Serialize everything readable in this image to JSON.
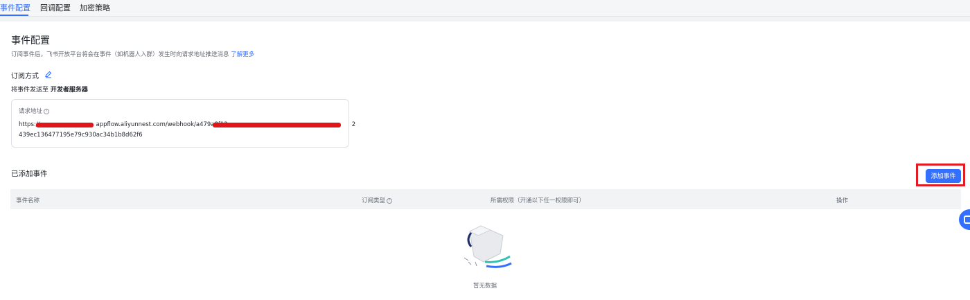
{
  "tabs": [
    "事件配置",
    "回调配置",
    "加密策略"
  ],
  "page": {
    "title": "事件配置",
    "description": "订阅事件后，飞书开放平台将会在事件（如机器人入群）发生时向请求地址推送消息",
    "learn_more": "了解更多"
  },
  "subscription": {
    "title": "订阅方式",
    "send_prefix": "将事件发送至",
    "send_target": "开发者服务器"
  },
  "request_url": {
    "label": "请求地址",
    "line1_prefix": "https://",
    "line1_mid": "appflow.aliyunnest.com/webhook/a479a8f12",
    "line1_suffix": "2",
    "line2": "439ec136477195e79c930ac34b1b8d62f6"
  },
  "events": {
    "title": "已添加事件",
    "add_button": "添加事件",
    "columns": [
      "事件名称",
      "订阅类型",
      "所需权限（开通以下任一权限即可）",
      "操作"
    ],
    "empty_text": "暂无数据"
  },
  "colors": {
    "accent": "#3370ff",
    "highlight_border": "#e01b22",
    "redaction": "#e0161b"
  },
  "icons": [
    "edit-icon",
    "help-icon",
    "empty-box-illustration",
    "floating-assistant-icon"
  ]
}
